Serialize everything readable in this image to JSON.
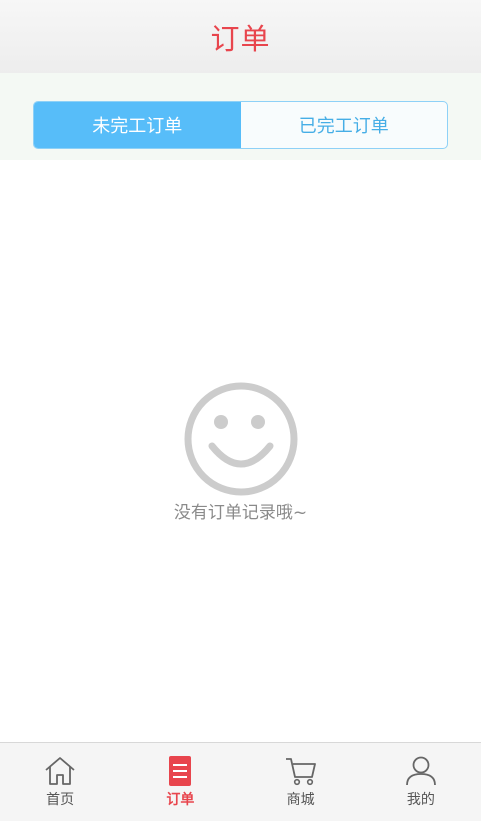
{
  "header": {
    "title": "订单"
  },
  "tabs": [
    {
      "label": "未完工订单",
      "active": true
    },
    {
      "label": "已完工订单",
      "active": false
    }
  ],
  "empty_state": {
    "icon": "smiley-face-icon",
    "message": "没有订单记录哦~"
  },
  "bottom_nav": [
    {
      "label": "首页",
      "icon": "home-icon",
      "active": false
    },
    {
      "label": "订单",
      "icon": "order-list-icon",
      "active": true
    },
    {
      "label": "商城",
      "icon": "cart-icon",
      "active": false
    },
    {
      "label": "我的",
      "icon": "user-icon",
      "active": false
    }
  ],
  "colors": {
    "accent_red": "#e8454d",
    "tab_active": "#57bdf9",
    "tab_text": "#46aee6",
    "tab_border": "#8ed1f7"
  }
}
